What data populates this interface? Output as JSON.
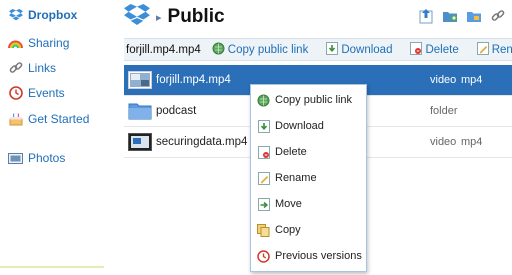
{
  "sidebar": {
    "brand": "Dropbox",
    "items": [
      {
        "label": "Sharing"
      },
      {
        "label": "Links"
      },
      {
        "label": "Events"
      },
      {
        "label": "Get Started"
      },
      {
        "label": "Photos"
      }
    ]
  },
  "header": {
    "title": "Public"
  },
  "actionbar": {
    "selected_name": "forjill.mp4.mp4",
    "copy_link": "Copy public link",
    "download": "Download",
    "delete": "Delete",
    "rename": "Rename"
  },
  "files": [
    {
      "name": "forjill.mp4.mp4",
      "type": "video",
      "ext": "mp4"
    },
    {
      "name": "podcast",
      "type": "folder",
      "ext": ""
    },
    {
      "name": "securingdata.mp4",
      "type": "video",
      "ext": "mp4"
    }
  ],
  "context_menu": [
    {
      "label": "Copy public link",
      "icon": "globe-link-icon"
    },
    {
      "label": "Download",
      "icon": "download-icon"
    },
    {
      "label": "Delete",
      "icon": "delete-icon"
    },
    {
      "label": "Rename",
      "icon": "rename-icon"
    },
    {
      "label": "Move",
      "icon": "move-icon"
    },
    {
      "label": "Copy",
      "icon": "copy-icon"
    },
    {
      "label": "Previous versions",
      "icon": "history-icon"
    }
  ],
  "colors": {
    "link": "#1f6fb8",
    "selected_row": "#2b6fb8",
    "actionbar_bg": "#eef3f8"
  }
}
